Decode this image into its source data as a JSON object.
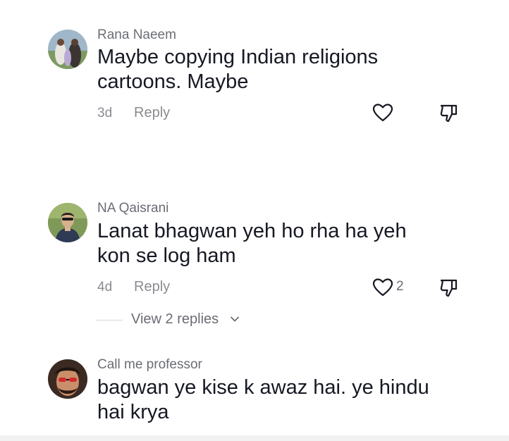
{
  "comments": [
    {
      "username": "Rana Naeem",
      "text_lines": [
        "Maybe copying Indian religions",
        "cartoons. Maybe"
      ],
      "time": "3d",
      "reply_label": "Reply",
      "like_count": ""
    },
    {
      "username": "NA Qaisrani",
      "text_lines": [
        "Lanat bhagwan yeh ho rha ha yeh",
        "kon se log ham"
      ],
      "time": "4d",
      "reply_label": "Reply",
      "like_count": "2"
    },
    {
      "username": "Call me professor",
      "text_lines": [
        "bagwan ye kise k awaz hai. ye hindu",
        "hai krya"
      ],
      "time": "",
      "reply_label": "",
      "like_count": ""
    }
  ],
  "view_replies": {
    "label": "View 2 replies"
  },
  "icons": {
    "like": "heart-outline-icon",
    "dislike": "thumbs-down-icon",
    "expand": "chevron-down-icon"
  },
  "colors": {
    "primary_text": "#161823",
    "secondary_text": "#8a8b91",
    "username": "#6b6d75"
  }
}
